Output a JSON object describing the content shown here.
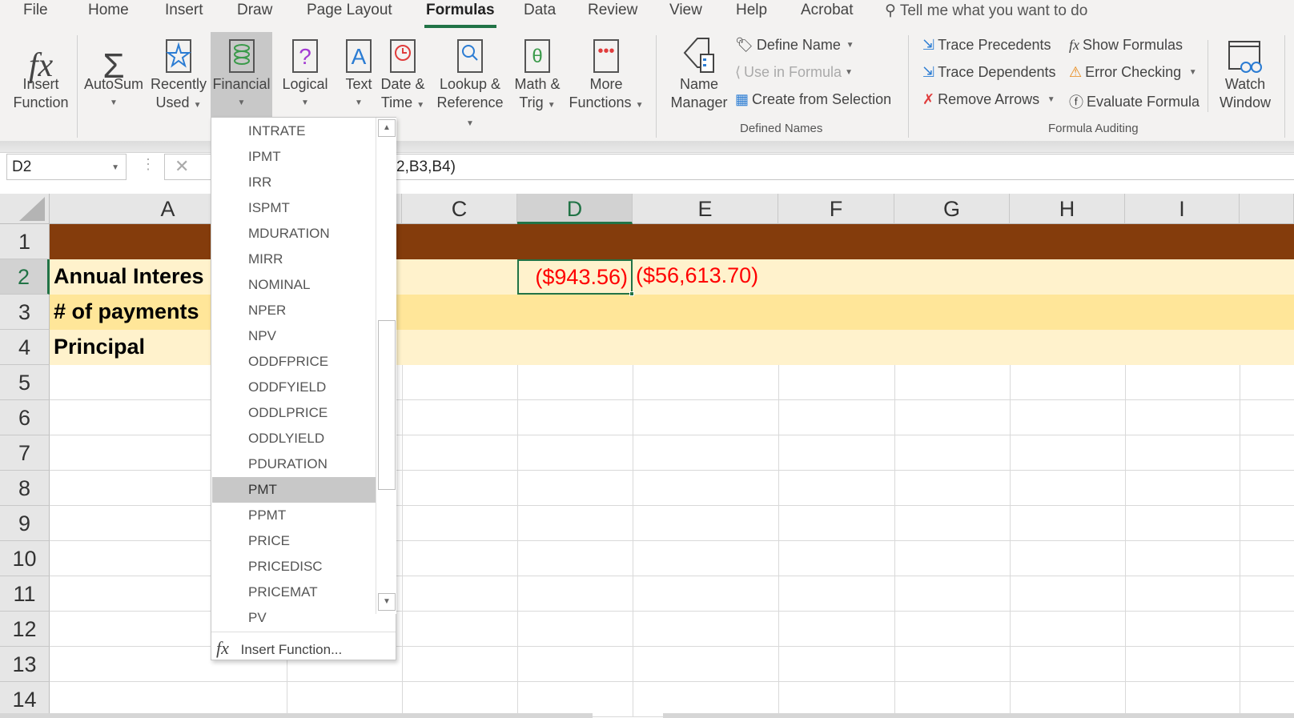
{
  "tabs": [
    "File",
    "Home",
    "Insert",
    "Draw",
    "Page Layout",
    "Formulas",
    "Data",
    "Review",
    "View",
    "Help",
    "Acrobat"
  ],
  "active_tab": "Formulas",
  "tell_me": "Tell me what you want to do",
  "ribbon": {
    "insert_function": [
      "Insert",
      "Function"
    ],
    "autosum": "AutoSum",
    "recently_used": [
      "Recently",
      "Used"
    ],
    "financial": "Financial",
    "logical": "Logical",
    "text": "Text",
    "date_time": [
      "Date &",
      "Time"
    ],
    "lookup": [
      "Lookup &",
      "Reference"
    ],
    "math": [
      "Math &",
      "Trig"
    ],
    "more": [
      "More",
      "Functions"
    ],
    "name_manager": [
      "Name",
      "Manager"
    ],
    "define_name": "Define Name",
    "use_in_formula": "Use in Formula",
    "create_from_selection": "Create from Selection",
    "defined_names_group": "Defined Names",
    "trace_precedents": "Trace Precedents",
    "trace_dependents": "Trace Dependents",
    "remove_arrows": "Remove Arrows",
    "show_formulas": "Show Formulas",
    "error_checking": "Error Checking",
    "evaluate_formula": "Evaluate Formula",
    "watch_window": [
      "Watch",
      "Window"
    ],
    "formula_auditing_group": "Formula Auditing"
  },
  "formula_bar": {
    "name_box": "D2",
    "formula_visible": "2,B3,B4)"
  },
  "columns": [
    "A",
    "B",
    "C",
    "D",
    "E",
    "F",
    "G",
    "H",
    "I"
  ],
  "rows": [
    "1",
    "2",
    "3",
    "4",
    "5",
    "6",
    "7",
    "8",
    "9",
    "10",
    "11",
    "12",
    "13",
    "14"
  ],
  "selected_cell": "D2",
  "cells": {
    "A2": "Annual Interes",
    "A3": "# of payments",
    "A4": "Principal",
    "D2": "($943.56)",
    "E2": "($56,613.70)"
  },
  "colors": {
    "row1": "#843C0C",
    "row2": "#FFF2CC",
    "row3": "#FFE699",
    "row4": "#FFF2CC",
    "negative": "#FF0000",
    "accent": "#217346"
  },
  "dropdown": {
    "items": [
      "INTRATE",
      "IPMT",
      "IRR",
      "ISPMT",
      "MDURATION",
      "MIRR",
      "NOMINAL",
      "NPER",
      "NPV",
      "ODDFPRICE",
      "ODDFYIELD",
      "ODDLPRICE",
      "ODDLYIELD",
      "PDURATION",
      "PMT",
      "PPMT",
      "PRICE",
      "PRICEDISC",
      "PRICEMAT",
      "PV"
    ],
    "highlighted": "PMT",
    "footer": "Insert Function..."
  }
}
